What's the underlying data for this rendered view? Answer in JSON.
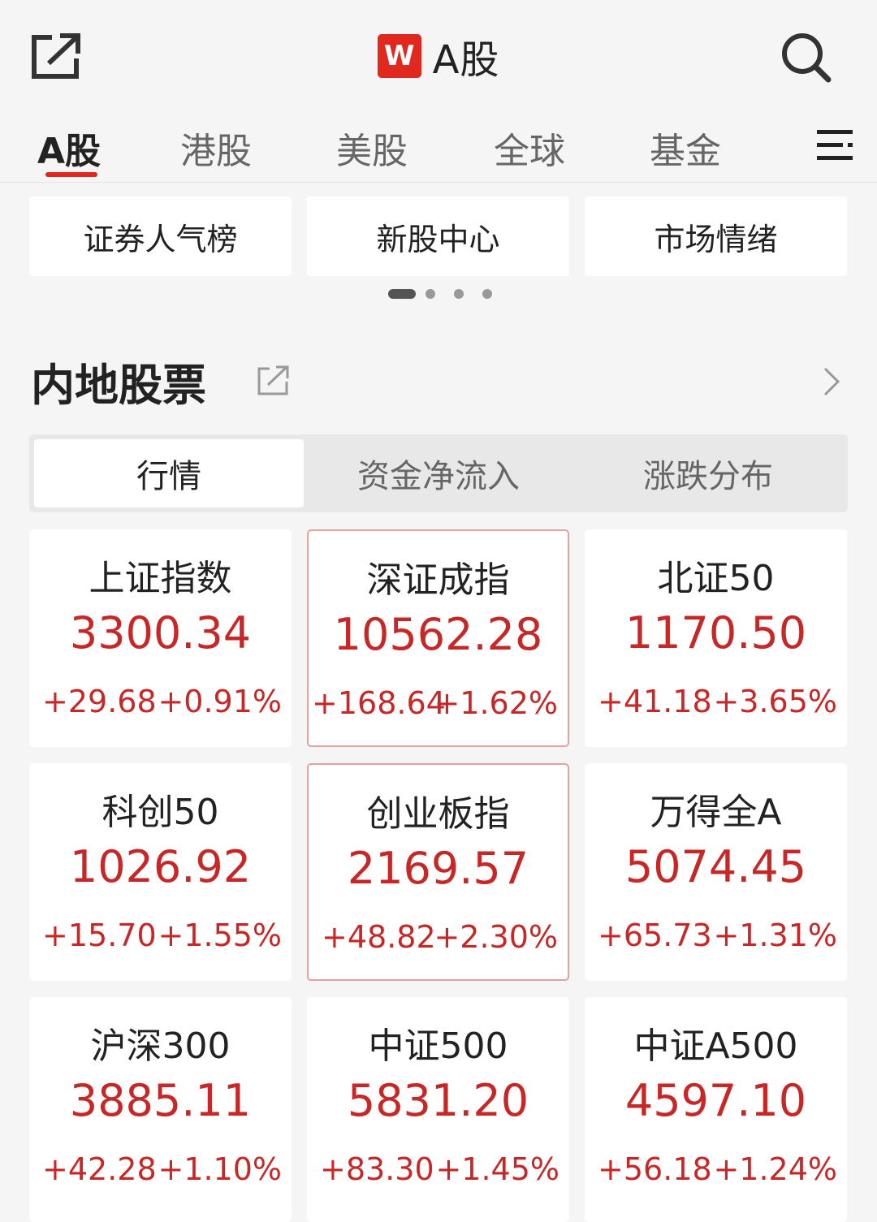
{
  "header": {
    "logo_letter": "W",
    "title": "A股"
  },
  "tabs": [
    {
      "label": "A股",
      "active": true
    },
    {
      "label": "港股"
    },
    {
      "label": "美股"
    },
    {
      "label": "全球"
    },
    {
      "label": "基金"
    }
  ],
  "shortcuts": [
    "证券人气榜",
    "新股中心",
    "市场情绪"
  ],
  "carousel": {
    "pages": 4,
    "active": 0
  },
  "section": {
    "title": "内地股票"
  },
  "segments": [
    {
      "label": "行情",
      "active": true
    },
    {
      "label": "资金净流入"
    },
    {
      "label": "涨跌分布"
    }
  ],
  "indices": [
    {
      "name": "上证指数",
      "value": "3300.34",
      "change": "+29.68",
      "pct": "+0.91%"
    },
    {
      "name": "深证成指",
      "value": "10562.28",
      "change": "+168.64",
      "pct": "+1.62%"
    },
    {
      "name": "北证50",
      "value": "1170.50",
      "change": "+41.18",
      "pct": "+3.65%"
    },
    {
      "name": "科创50",
      "value": "1026.92",
      "change": "+15.70",
      "pct": "+1.55%"
    },
    {
      "name": "创业板指",
      "value": "2169.57",
      "change": "+48.82",
      "pct": "+2.30%"
    },
    {
      "name": "万得全A",
      "value": "5074.45",
      "change": "+65.73",
      "pct": "+1.31%"
    },
    {
      "name": "沪深300",
      "value": "3885.11",
      "change": "+42.28",
      "pct": "+1.10%"
    },
    {
      "name": "中证500",
      "value": "5831.20",
      "change": "+83.30",
      "pct": "+1.45%"
    },
    {
      "name": "中证A500",
      "value": "4597.10",
      "change": "+56.18",
      "pct": "+1.24%"
    }
  ],
  "colors": {
    "accent": "#e0281e",
    "up": "#c62828"
  }
}
